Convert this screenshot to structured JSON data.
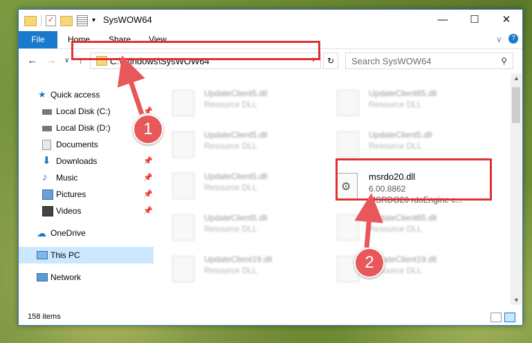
{
  "window": {
    "title": "SysWOW64",
    "minimize": "—",
    "maximize": "☐",
    "close": "✕"
  },
  "ribbon": {
    "tabs": [
      "File",
      "Home",
      "Share",
      "View"
    ],
    "collapse": "∨",
    "help": "?"
  },
  "nav": {
    "back": "←",
    "forward": "→",
    "recent": "∨",
    "up": "↑"
  },
  "address": {
    "path": "C:\\Windows\\SysWOW64",
    "dropdown": "∨",
    "refresh": "↻"
  },
  "search": {
    "placeholder": "Search SysWOW64"
  },
  "sidebar": {
    "items": [
      {
        "label": "Quick access",
        "icon": "star-icon",
        "pinned": false
      },
      {
        "label": "Local Disk (C:)",
        "icon": "drive-icon",
        "pinned": true
      },
      {
        "label": "Local Disk (D:)",
        "icon": "drive-icon",
        "pinned": false
      },
      {
        "label": "Documents",
        "icon": "documents-icon",
        "pinned": false
      },
      {
        "label": "Downloads",
        "icon": "downloads-icon",
        "pinned": true
      },
      {
        "label": "Music",
        "icon": "music-icon",
        "pinned": true
      },
      {
        "label": "Pictures",
        "icon": "pictures-icon",
        "pinned": true
      },
      {
        "label": "Videos",
        "icon": "videos-icon",
        "pinned": true
      },
      {
        "label": "OneDrive",
        "icon": "cloud-icon",
        "pinned": false
      },
      {
        "label": "This PC",
        "icon": "computer-icon",
        "pinned": false,
        "selected": true
      },
      {
        "label": "Network",
        "icon": "network-icon",
        "pinned": false
      }
    ]
  },
  "files": [
    {
      "name": "UpdateClient5.dll",
      "desc": "Resource DLL"
    },
    {
      "name": "UpdateClient65.dll",
      "desc": "Resource DLL"
    },
    {
      "name": "UpdateClient5.dll",
      "desc": "Resource DLL"
    },
    {
      "name": "UpdateClient5.dll",
      "desc": "Resource DLL"
    },
    {
      "name": "UpdateClient5.dll",
      "desc": "Resource DLL"
    },
    {
      "name": "UpdateClient5.dll",
      "desc": "Resource DLL"
    },
    {
      "name": "UpdateClient65.dll",
      "desc": "Resource DLL"
    },
    {
      "name": "UpdateClient19.dll",
      "desc": "Resource DLL"
    },
    {
      "name": "UpdateClient19.dll",
      "desc": "Resource DLL"
    }
  ],
  "target_file": {
    "name": "msrdo20.dll",
    "version": "6.00.8862",
    "description": "MSRDO20 rdoEngine c..."
  },
  "status": {
    "item_count": "158 items"
  },
  "annotations": {
    "step1": "1",
    "step2": "2",
    "highlight_color": "#e03030"
  }
}
